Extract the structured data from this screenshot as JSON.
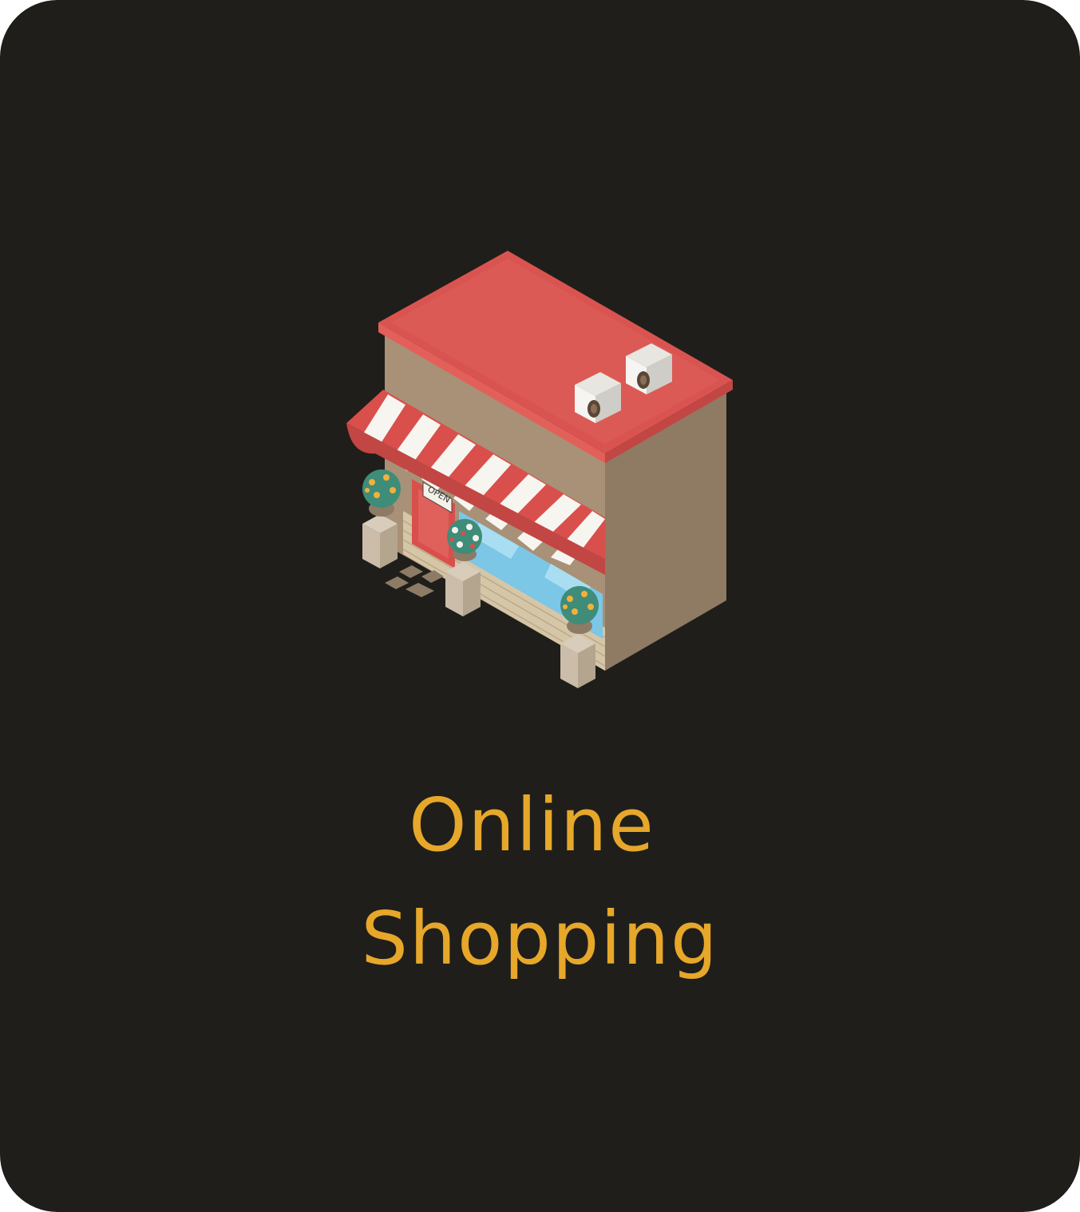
{
  "card": {
    "title_line_1": "Online",
    "title_line_2": "Shopping",
    "title_color": "#e6a72a",
    "background_color": "#1f1e1a"
  },
  "illustration": {
    "icon": "storefront-icon",
    "sign_text": "OPEN"
  }
}
